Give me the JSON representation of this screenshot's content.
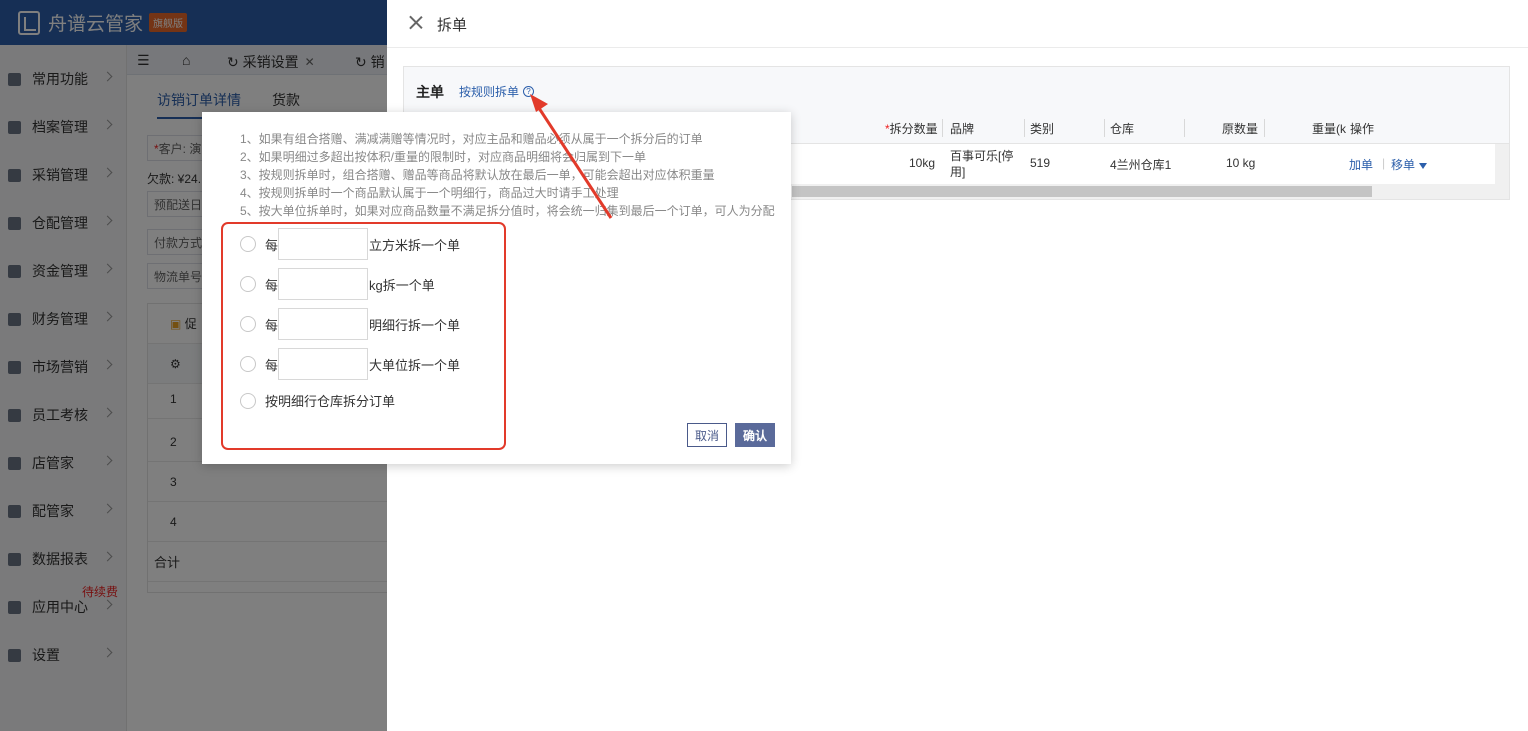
{
  "app": {
    "logo_text": "舟谱云管家",
    "edition_badge": "旗舰版",
    "sidebar": [
      {
        "label": "常用功能"
      },
      {
        "label": "档案管理"
      },
      {
        "label": "采销管理"
      },
      {
        "label": "仓配管理"
      },
      {
        "label": "资金管理"
      },
      {
        "label": "财务管理"
      },
      {
        "label": "市场营销"
      },
      {
        "label": "员工考核"
      },
      {
        "label": "店管家"
      },
      {
        "label": "配管家"
      },
      {
        "label": "数据报表"
      },
      {
        "label": "应用中心",
        "badge": "待续费"
      },
      {
        "label": "设置"
      }
    ],
    "tabs": [
      {
        "label": "采销设置"
      },
      {
        "label": "销"
      }
    ],
    "subtabs": [
      {
        "label": "访销订单详情"
      },
      {
        "label": "货款"
      }
    ],
    "form": {
      "customer": "客户: 演",
      "debt": "欠款: ¥24.",
      "delivery": "预配送日",
      "payment": "付款方式",
      "logistics": "物流单号"
    },
    "promo_button": "促",
    "grid_rows": [
      "1",
      "2",
      "3",
      "4"
    ],
    "grid_total": "合计"
  },
  "drawer": {
    "title": "拆单",
    "main_label": "主单",
    "rule_link": "按规则拆单",
    "columns": {
      "split_qty": "拆分数量",
      "brand": "品牌",
      "category": "类别",
      "warehouse": "仓库",
      "orig_qty": "原数量",
      "weight": "重量(k",
      "action": "操作"
    },
    "row": {
      "split_qty": "10kg",
      "brand": "百事可乐[停用]",
      "category": "519",
      "warehouse": "4兰州仓库1",
      "orig_qty": "10 kg",
      "add": "加单",
      "move": "移单"
    }
  },
  "popover": {
    "tips": [
      "1、如果有组合搭赠、满减满赠等情况时，对应主品和赠品必须从属于一个拆分后的订单",
      "2、如果明细过多超出按体积/重量的限制时，对应商品明细将会归属到下一单",
      "3、按规则拆单时，组合搭赠、赠品等商品将默认放在最后一单，可能会超出对应体积重量",
      "4、按规则拆单时一个商品默认属于一个明细行，商品过大时请手工处理",
      "5、按大单位拆单时，如果对应商品数量不满足拆分值时，将会统一归集到最后一个订单，可人为分配"
    ],
    "options": [
      {
        "prefix": "每",
        "suffix": "立方米拆一个单"
      },
      {
        "prefix": "每",
        "suffix": "kg拆一个单"
      },
      {
        "prefix": "每",
        "suffix": "明细行拆一个单"
      },
      {
        "prefix": "每",
        "suffix": "大单位拆一个单"
      }
    ],
    "warehouse_option": "按明细行仓库拆分订单",
    "cancel": "取消",
    "confirm": "确认"
  },
  "colors": {
    "primary": "#2c5fab",
    "highlight": "#e23a2a",
    "confirm_button": "#5a6a9a"
  }
}
